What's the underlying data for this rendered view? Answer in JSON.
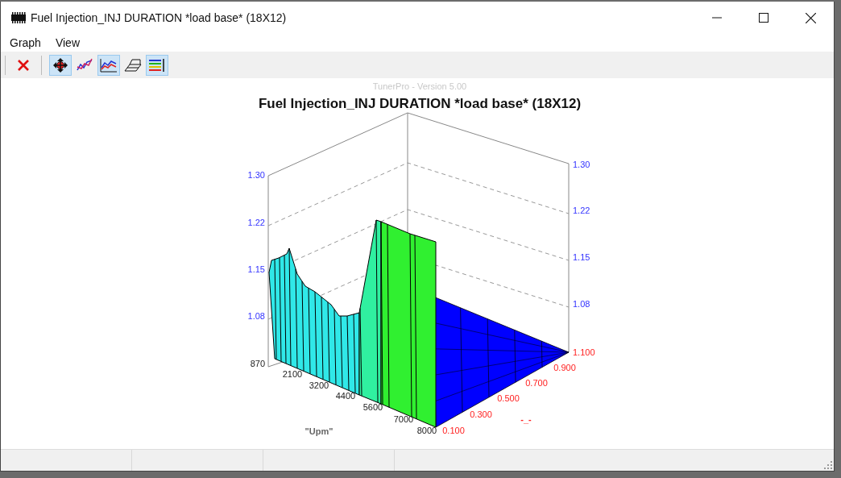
{
  "window": {
    "title": "Fuel Injection_INJ DURATION *load base* (18X12)"
  },
  "menu": [
    "Graph",
    "View"
  ],
  "toolbar": [
    {
      "kind": "close",
      "selected": false
    },
    {
      "kind": "move",
      "selected": true
    },
    {
      "kind": "line",
      "selected": false
    },
    {
      "kind": "plot",
      "selected": true
    },
    {
      "kind": "mesh",
      "selected": false
    },
    {
      "kind": "legend",
      "selected": true
    }
  ],
  "chart": {
    "watermark": "TunerPro - Version 5.00",
    "title": "Fuel Injection_INJ DURATION *load base* (18X12)",
    "left_ticks": [
      "1.30",
      "1.22",
      "1.15",
      "1.08",
      "870"
    ],
    "right_ticks": [
      "1.30",
      "1.22",
      "1.15",
      "1.08"
    ],
    "x_ticks": [
      "2100",
      "3200",
      "4400",
      "5600",
      "7000",
      "8000"
    ],
    "x_label": "\"Upm\"",
    "depth_ticks": [
      "0.100",
      "0.300",
      "0.500",
      "0.700",
      "0.900",
      "1.100"
    ],
    "depth_label": "-_-"
  }
}
